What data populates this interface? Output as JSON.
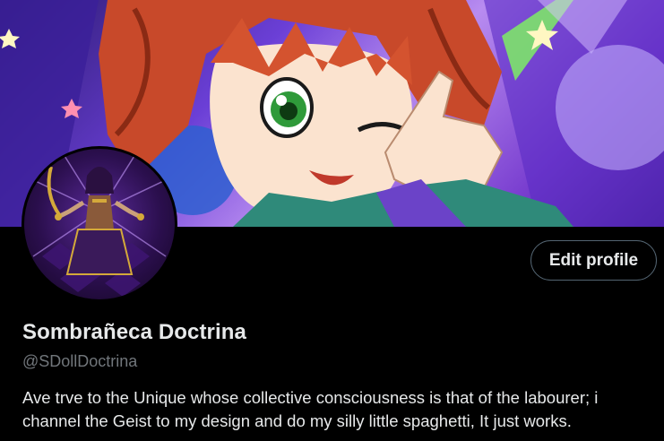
{
  "profile": {
    "display_name": "Sombrañeca Doctrina",
    "handle": "@SDollDoctrina",
    "bio": "Ave trve to the Unique whose collective consciousness is that of the labourer; i channel the Geist to my design and do my silly little spaghetti, It just works."
  },
  "actions": {
    "edit_profile_label": "Edit profile"
  },
  "colors": {
    "background": "#000000",
    "primary_text": "#e7e9ea",
    "secondary_text": "#71767b",
    "button_border": "#536471"
  }
}
